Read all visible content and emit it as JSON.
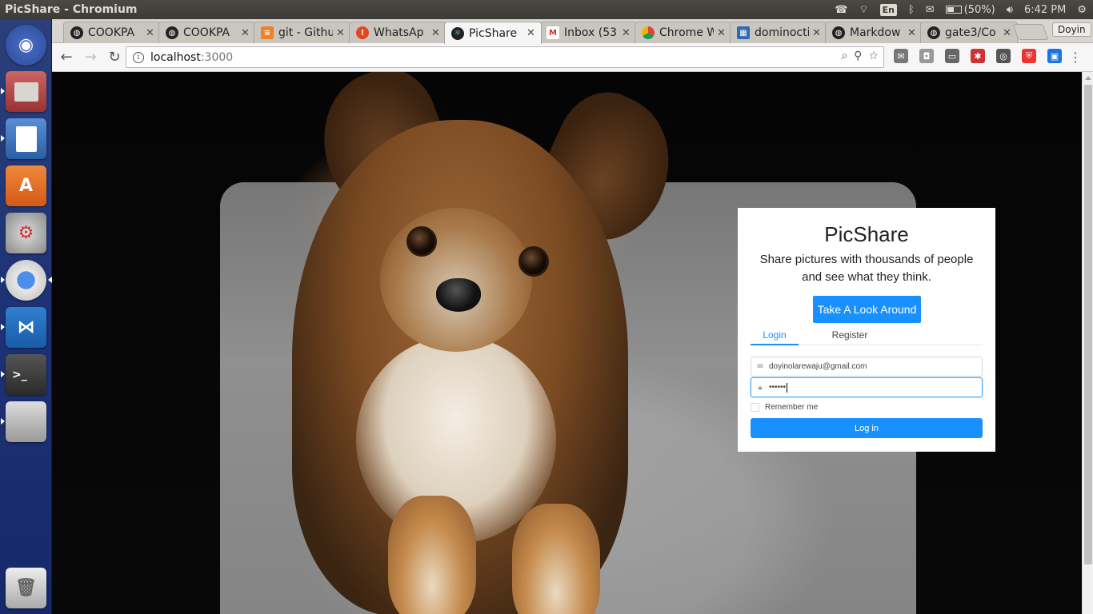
{
  "window": {
    "title": "PicShare - Chromium"
  },
  "indicators": {
    "keyboard": "En",
    "battery": "(50%)",
    "time": "6:42 PM"
  },
  "launcher": {
    "items": [
      {
        "name": "ubuntu-dash-icon"
      },
      {
        "name": "files-icon"
      },
      {
        "name": "writer-icon"
      },
      {
        "name": "software-center-icon"
      },
      {
        "name": "system-settings-icon"
      },
      {
        "name": "chromium-icon"
      },
      {
        "name": "vscode-icon"
      },
      {
        "name": "terminal-icon"
      },
      {
        "name": "drive-icon"
      },
      {
        "name": "trash-icon"
      }
    ]
  },
  "tabs": [
    {
      "label": "COOKPA",
      "icon": "github-icon"
    },
    {
      "label": "COOKPA",
      "icon": "github-icon"
    },
    {
      "label": "git - Githu",
      "icon": "stackoverflow-icon"
    },
    {
      "label": "WhatsAp",
      "icon": "whatsapp-icon"
    },
    {
      "label": "PicShare",
      "icon": "react-icon"
    },
    {
      "label": "Inbox (53",
      "icon": "gmail-icon"
    },
    {
      "label": "Chrome W",
      "icon": "chrome-store-icon"
    },
    {
      "label": "dominocti",
      "icon": "dominoc-icon"
    },
    {
      "label": "Markdow",
      "icon": "github-icon"
    },
    {
      "label": "gate3/Co",
      "icon": "github-icon"
    }
  ],
  "profile": {
    "name": "Doyin"
  },
  "omnibox": {
    "host": "localhost",
    "port": ":3000"
  },
  "page": {
    "brand": "PicShare",
    "tagline": "Share pictures with thousands of people and see what they think.",
    "look_button": "Take A Look Around",
    "tabs": {
      "login": "Login",
      "register": "Register"
    },
    "email": "doyinolarewaju@gmail.com",
    "password": "••••••",
    "remember": "Remember me",
    "login_button": "Log in"
  },
  "colors": {
    "accent": "#1890ff",
    "launcher": "#1d3275",
    "panel": "#3c3b37"
  }
}
